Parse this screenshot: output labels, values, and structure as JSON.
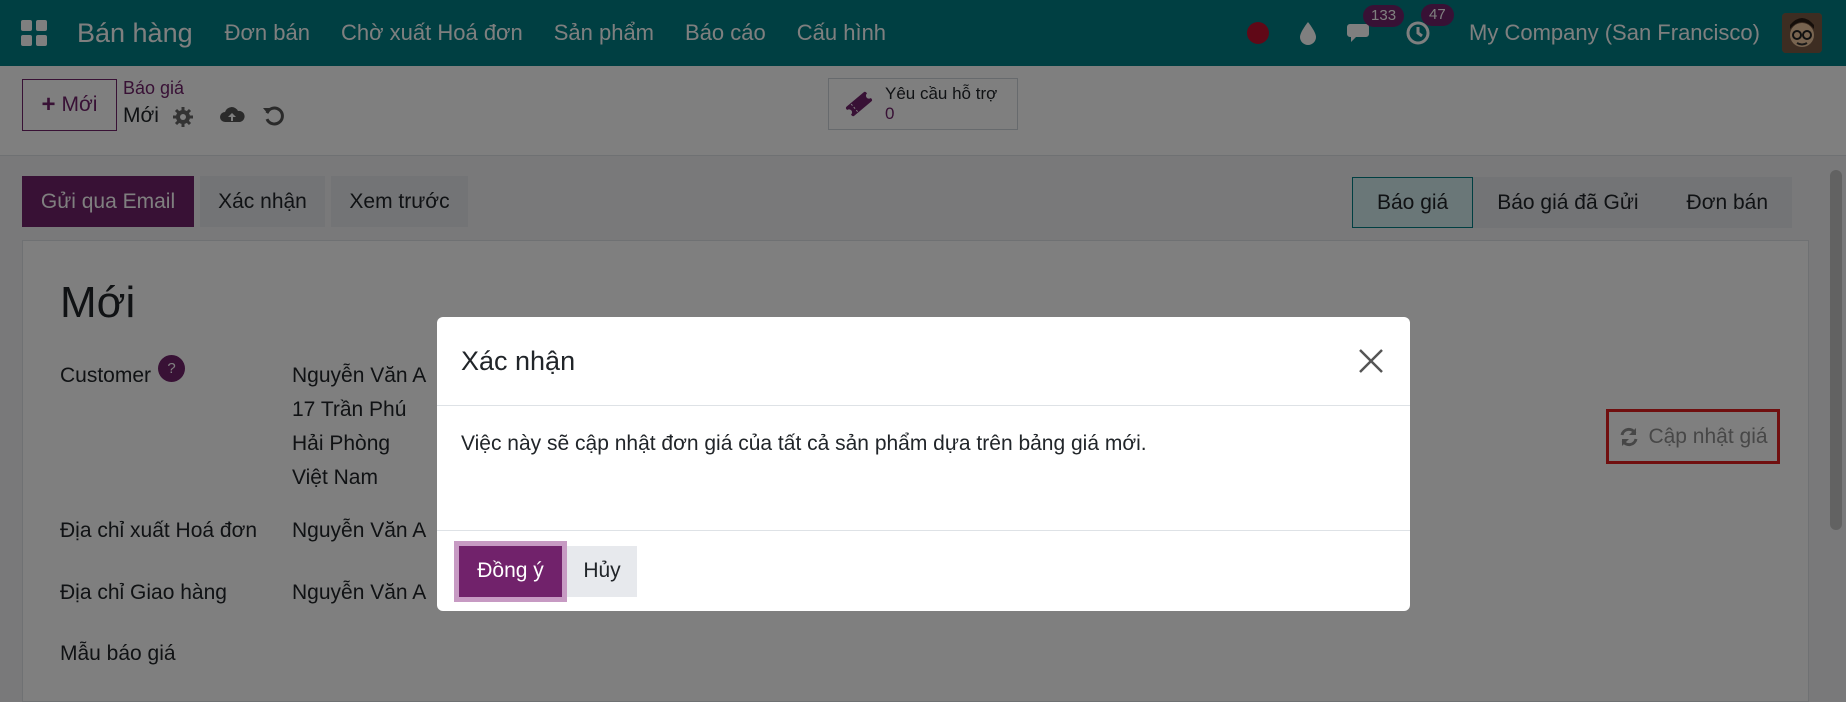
{
  "navbar": {
    "brand": "Bán hàng",
    "menu": [
      "Đơn bán",
      "Chờ xuất Hoá đơn",
      "Sản phẩm",
      "Báo cáo",
      "Cấu hình"
    ],
    "messages_count": "133",
    "activities_count": "47",
    "company": "My Company (San Francisco)"
  },
  "control": {
    "new_label": "Mới",
    "breadcrumb_parent": "Báo giá",
    "breadcrumb_current": "Mới",
    "support_label": "Yêu cầu hỗ trợ",
    "support_count": "0"
  },
  "actions": {
    "send_email": "Gửi qua Email",
    "confirm": "Xác nhận",
    "preview": "Xem trước"
  },
  "stages": [
    "Báo giá",
    "Báo giá đã Gửi",
    "Đơn bán"
  ],
  "form": {
    "title": "Mới",
    "customer_label": "Customer",
    "help_mark": "?",
    "customer_lines": [
      "Nguyễn Văn A",
      "17 Trần Phú",
      "Hải Phòng",
      "Việt Nam"
    ],
    "invoice_address_label": "Địa chỉ xuất Hoá đơn",
    "invoice_address_value": "Nguyễn Văn A",
    "delivery_address_label": "Địa chỉ Giao hàng",
    "delivery_address_value": "Nguyễn Văn A",
    "quotation_template_label": "Mẫu báo giá",
    "update_prices": "Cập nhật giá"
  },
  "dialog": {
    "title": "Xác nhận",
    "body": "Việc này sẽ cập nhật đơn giá của tất cả sản phẩm dựa trên bảng giá mới.",
    "ok": "Đồng ý",
    "cancel": "Hủy"
  }
}
